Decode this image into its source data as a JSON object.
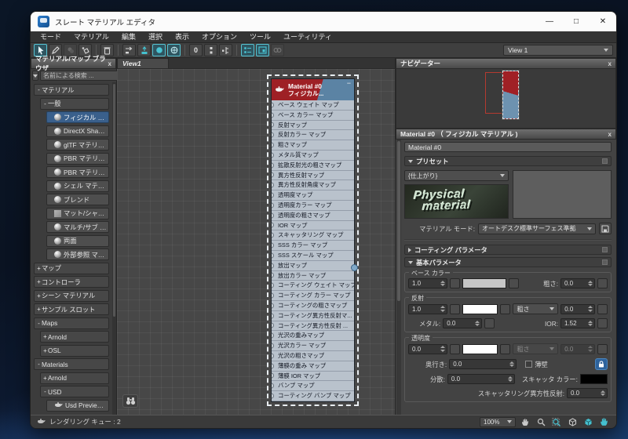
{
  "window": {
    "title": "スレート マテリアル エディタ",
    "controls": {
      "min": "—",
      "max": "□",
      "close": "✕"
    }
  },
  "ui": {
    "close_glyph": "x"
  },
  "menu": {
    "items": [
      "モード",
      "マテリアル",
      "編集",
      "選択",
      "表示",
      "オプション",
      "ツール",
      "ユーティリティ"
    ]
  },
  "toolbar": {
    "view_selector": "View 1",
    "sample_label": "0"
  },
  "browser": {
    "title": "マテリアル/マップ ブラウザ",
    "search_placeholder": "名前による検索 ...",
    "tree": [
      {
        "type": "group",
        "expand": "-",
        "label": "マテリアル",
        "level": 0
      },
      {
        "type": "group",
        "expand": "-",
        "label": "一般",
        "level": 1
      },
      {
        "type": "item",
        "icon": "sphere",
        "label": "フィジカル マテリアル",
        "level": 2,
        "selected": true
      },
      {
        "type": "item",
        "icon": "sphere",
        "label": "DirectX Shader",
        "level": 2
      },
      {
        "type": "item",
        "icon": "sphere",
        "label": "glTF マテリアル",
        "level": 2
      },
      {
        "type": "item",
        "icon": "sphere",
        "label": "PBR マテリアル(メタル ...",
        "level": 2
      },
      {
        "type": "item",
        "icon": "sphere",
        "label": "PBR マテリアル(鏡面...",
        "level": 2
      },
      {
        "type": "item",
        "icon": "sphere",
        "label": "シェル マテリアル",
        "level": 2
      },
      {
        "type": "item",
        "icon": "sphere",
        "label": "ブレンド",
        "level": 2
      },
      {
        "type": "item",
        "icon": "square",
        "label": "マット/シャドウ",
        "level": 2
      },
      {
        "type": "item",
        "icon": "sphere",
        "label": "マルチ/サブ オブジェクト",
        "level": 2
      },
      {
        "type": "item",
        "icon": "sphere",
        "label": "両面",
        "level": 2
      },
      {
        "type": "item",
        "icon": "sphere",
        "label": "外部参照 マテリアル",
        "level": 2
      },
      {
        "type": "group",
        "expand": "+",
        "label": "マップ",
        "level": 0
      },
      {
        "type": "group",
        "expand": "+",
        "label": "コントローラ",
        "level": 0
      },
      {
        "type": "group",
        "expand": "+",
        "label": "シーン マテリアル",
        "level": 0
      },
      {
        "type": "group",
        "expand": "+",
        "label": "サンプル スロット",
        "level": 0
      },
      {
        "type": "group",
        "expand": "-",
        "label": "Maps",
        "level": 0
      },
      {
        "type": "group",
        "expand": "+",
        "label": "Arnold",
        "level": 1
      },
      {
        "type": "group",
        "expand": "+",
        "label": "OSL",
        "level": 1
      },
      {
        "type": "group",
        "expand": "-",
        "label": "Materials",
        "level": 0
      },
      {
        "type": "group",
        "expand": "+",
        "label": "Arnold",
        "level": 1
      },
      {
        "type": "group",
        "expand": "-",
        "label": "USD",
        "level": 1
      },
      {
        "type": "item",
        "icon": "teapot",
        "label": "Usd Preview Surface",
        "level": 2
      }
    ]
  },
  "view": {
    "tab": "View1",
    "node": {
      "title": "Material #0",
      "subtitle": "フィジカル...",
      "collapse_glyph": "−",
      "slots": [
        "ベース ウェイト マップ",
        "ベース カラー マップ",
        "反射マップ",
        "反射カラー マップ",
        "粗さマップ",
        "メタル質マップ",
        "拡散反射光の粗さマップ",
        "異方性反射マップ",
        "異方性反射角度マップ",
        "透明度マップ",
        "透明度カラー マップ",
        "透明度の粗さマップ",
        "IOR マップ",
        "スキャッタリング マップ",
        "SSS カラー マップ",
        "SSS スケール マップ",
        "放出マップ",
        "放出カラー マップ",
        "コーティング ウェイト マップ",
        "コーティング カラー マップ",
        "コーティングの粗さマップ",
        "コーティング異方性反射マ...",
        "コーティング異方性反射 ...",
        "光沢の重みマップ",
        "光沢カラー マップ",
        "光沢の粗さマップ",
        "薄膜の重み マップ",
        "薄膜 IOR マップ",
        "バンプ マップ",
        "コーティング バンプ マップ"
      ]
    }
  },
  "navigator": {
    "title": "ナビゲーター"
  },
  "params": {
    "title": "Material #0 （ フィジカル マテリアル )",
    "name_value": "Material #0",
    "preset": {
      "section": "プリセット",
      "value": "{仕上がり}",
      "preview_line1": "Physical",
      "preview_line2": "material"
    },
    "mode": {
      "label": "マテリアル モード:",
      "value": "オートデスク標準サーフェス準拠"
    },
    "sections": {
      "coating": "コーティング パラメータ",
      "basic": "基本パラメータ"
    },
    "base_color": {
      "legend": "ベース カラー",
      "weight": "1.0",
      "rough_label": "粗さ:",
      "rough": "0.0",
      "swatch": "#c6c6c6"
    },
    "reflection": {
      "legend": "反射",
      "weight": "1.0",
      "rough_mode": "粗さ",
      "rough": "0.0",
      "metal_label": "メタル:",
      "metal": "0.0",
      "ior_label": "IOR:",
      "ior": "1.52",
      "swatch": "#ffffff"
    },
    "transparency": {
      "legend": "透明度",
      "weight": "0.0",
      "rough_mode": "粗さ",
      "rough": "0.0",
      "depth_label": "奥行き:",
      "depth": "0.0",
      "thin_label": "薄壁",
      "disp_label": "分散:",
      "disp": "0.0",
      "scatter_label": "スキャッタ カラー:",
      "scatter_swatch": "#000000",
      "sss_label": "スキャッタリング異方性反射:",
      "sss": "0.0",
      "swatch": "#ffffff"
    }
  },
  "statusbar": {
    "queue": "レンダリング キュー : 2",
    "zoom": "100%"
  },
  "colors": {
    "accent_teal": "#55c3d2",
    "node_red": "#9e2025",
    "node_blue": "#5b83a4",
    "selection_blue": "#3a608c"
  }
}
